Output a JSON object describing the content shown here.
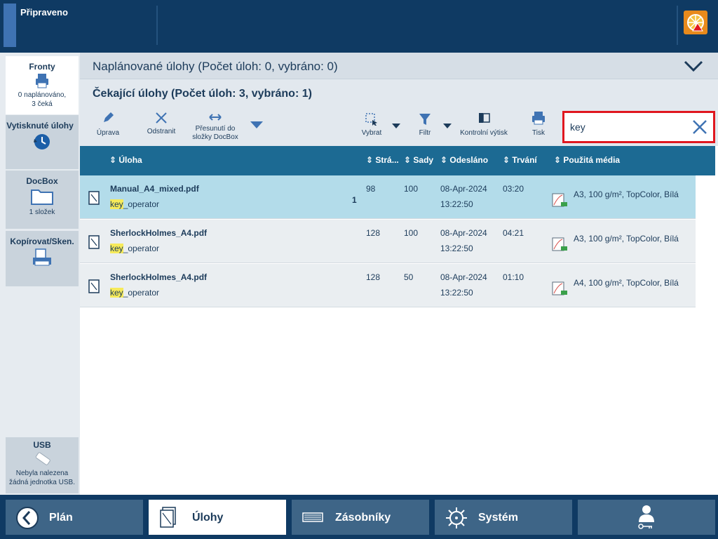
{
  "topbar": {
    "status": "Připraveno"
  },
  "sidebar": {
    "queues": {
      "title": "Fronty",
      "sub1": "0 naplánováno,",
      "sub2": "3 čeká"
    },
    "printed": {
      "title": "Vytisknuté úlohy"
    },
    "docbox": {
      "title": "DocBox",
      "sub": "1 složek"
    },
    "copy": {
      "title": "Kopírovat/Sken."
    },
    "usb": {
      "title": "USB",
      "sub1": "Nebyla nalezena",
      "sub2": "žádná jednotka USB."
    }
  },
  "main": {
    "planned_title": "Naplánované úlohy (Počet úloh: 0, vybráno: 0)",
    "waiting_title": "Čekající úlohy (Počet úloh: 3, vybráno: 1)"
  },
  "toolbar": {
    "edit": "Úprava",
    "delete": "Odstranit",
    "move1": "Přesunutí do",
    "move2": "složky DocBox",
    "select": "Vybrat",
    "filter": "Filtr",
    "proof": "Kontrolní výtisk",
    "print": "Tisk"
  },
  "search": {
    "value": "key"
  },
  "columns": {
    "job": "Úloha",
    "pages": "Strá...",
    "sets": "Sady",
    "sent": "Odesláno",
    "duration": "Trvání",
    "media": "Použitá média"
  },
  "jobs": [
    {
      "name": "Manual_A4_mixed.pdf",
      "owner_hl": "key",
      "owner_rest": "_operator",
      "copies": "1",
      "pages": "98",
      "sets": "100",
      "date": "08-Apr-2024",
      "time": "13:22:50",
      "duration": "03:20",
      "media": "A3, 100 g/m², TopColor, Bílá"
    },
    {
      "name": "SherlockHolmes_A4.pdf",
      "owner_hl": "key",
      "owner_rest": "_operator",
      "copies": "",
      "pages": "128",
      "sets": "100",
      "date": "08-Apr-2024",
      "time": "13:22:50",
      "duration": "04:21",
      "media": "A3, 100 g/m², TopColor, Bílá"
    },
    {
      "name": "SherlockHolmes_A4.pdf",
      "owner_hl": "key",
      "owner_rest": "_operator",
      "copies": "",
      "pages": "128",
      "sets": "50",
      "date": "08-Apr-2024",
      "time": "13:22:50",
      "duration": "01:10",
      "media": "A4, 100 g/m², TopColor, Bílá"
    }
  ],
  "bottom_nav": {
    "plan": "Plán",
    "jobs": "Úlohy",
    "trays": "Zásobníky",
    "system": "Systém"
  }
}
